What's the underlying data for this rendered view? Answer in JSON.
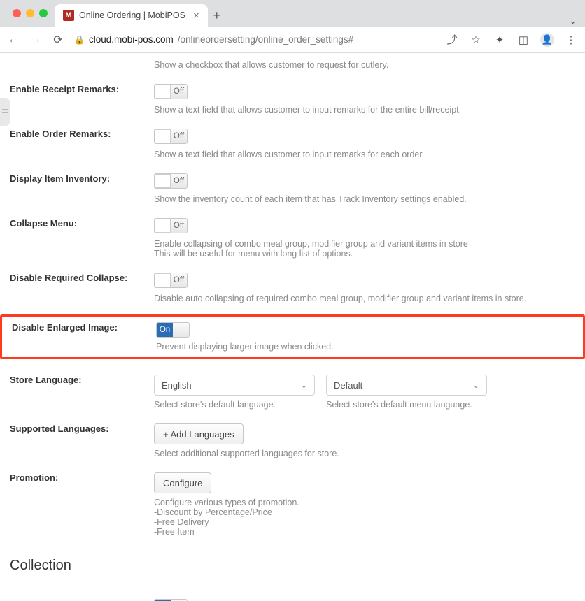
{
  "browser": {
    "tab_title": "Online Ordering | MobiPOS",
    "favicon_letter": "M",
    "url_host": "cloud.mobi-pos.com",
    "url_path": "/onlineordersetting/online_order_settings#"
  },
  "first_helper": "Show a checkbox that allows customer to request for cutlery.",
  "settings": {
    "receipt_remarks": {
      "label": "Enable Receipt Remarks:",
      "state": "Off",
      "helper": "Show a text field that allows customer to input remarks for the entire bill/receipt."
    },
    "order_remarks": {
      "label": "Enable Order Remarks:",
      "state": "Off",
      "helper": "Show a text field that allows customer to input remarks for each order."
    },
    "item_inventory": {
      "label": "Display Item Inventory:",
      "state": "Off",
      "helper": "Show the inventory count of each item that has Track Inventory settings enabled."
    },
    "collapse_menu": {
      "label": "Collapse Menu:",
      "state": "Off",
      "helper": "Enable collapsing of combo meal group, modifier group and variant items in store\nThis will be useful for menu with long list of options."
    },
    "required_collapse": {
      "label": "Disable Required Collapse:",
      "state": "Off",
      "helper": "Disable auto collapsing of required combo meal group, modifier group and variant items in store."
    },
    "enlarged_image": {
      "label": "Disable Enlarged Image:",
      "state": "On",
      "helper": "Prevent displaying larger image when clicked."
    },
    "store_language": {
      "label": "Store Language:",
      "value": "English",
      "menu_value": "Default",
      "helper_left": "Select store's default language.",
      "helper_right": "Select store's default menu language."
    },
    "supported_languages": {
      "label": "Supported Languages:",
      "button": "+ Add Languages",
      "helper": "Select additional supported languages for store."
    },
    "promotion": {
      "label": "Promotion:",
      "button": "Configure",
      "helper": "Configure various types of promotion.\n-Discount by Percentage/Price\n-Free Delivery\n-Free Item"
    }
  },
  "section": {
    "collection": "Collection"
  }
}
